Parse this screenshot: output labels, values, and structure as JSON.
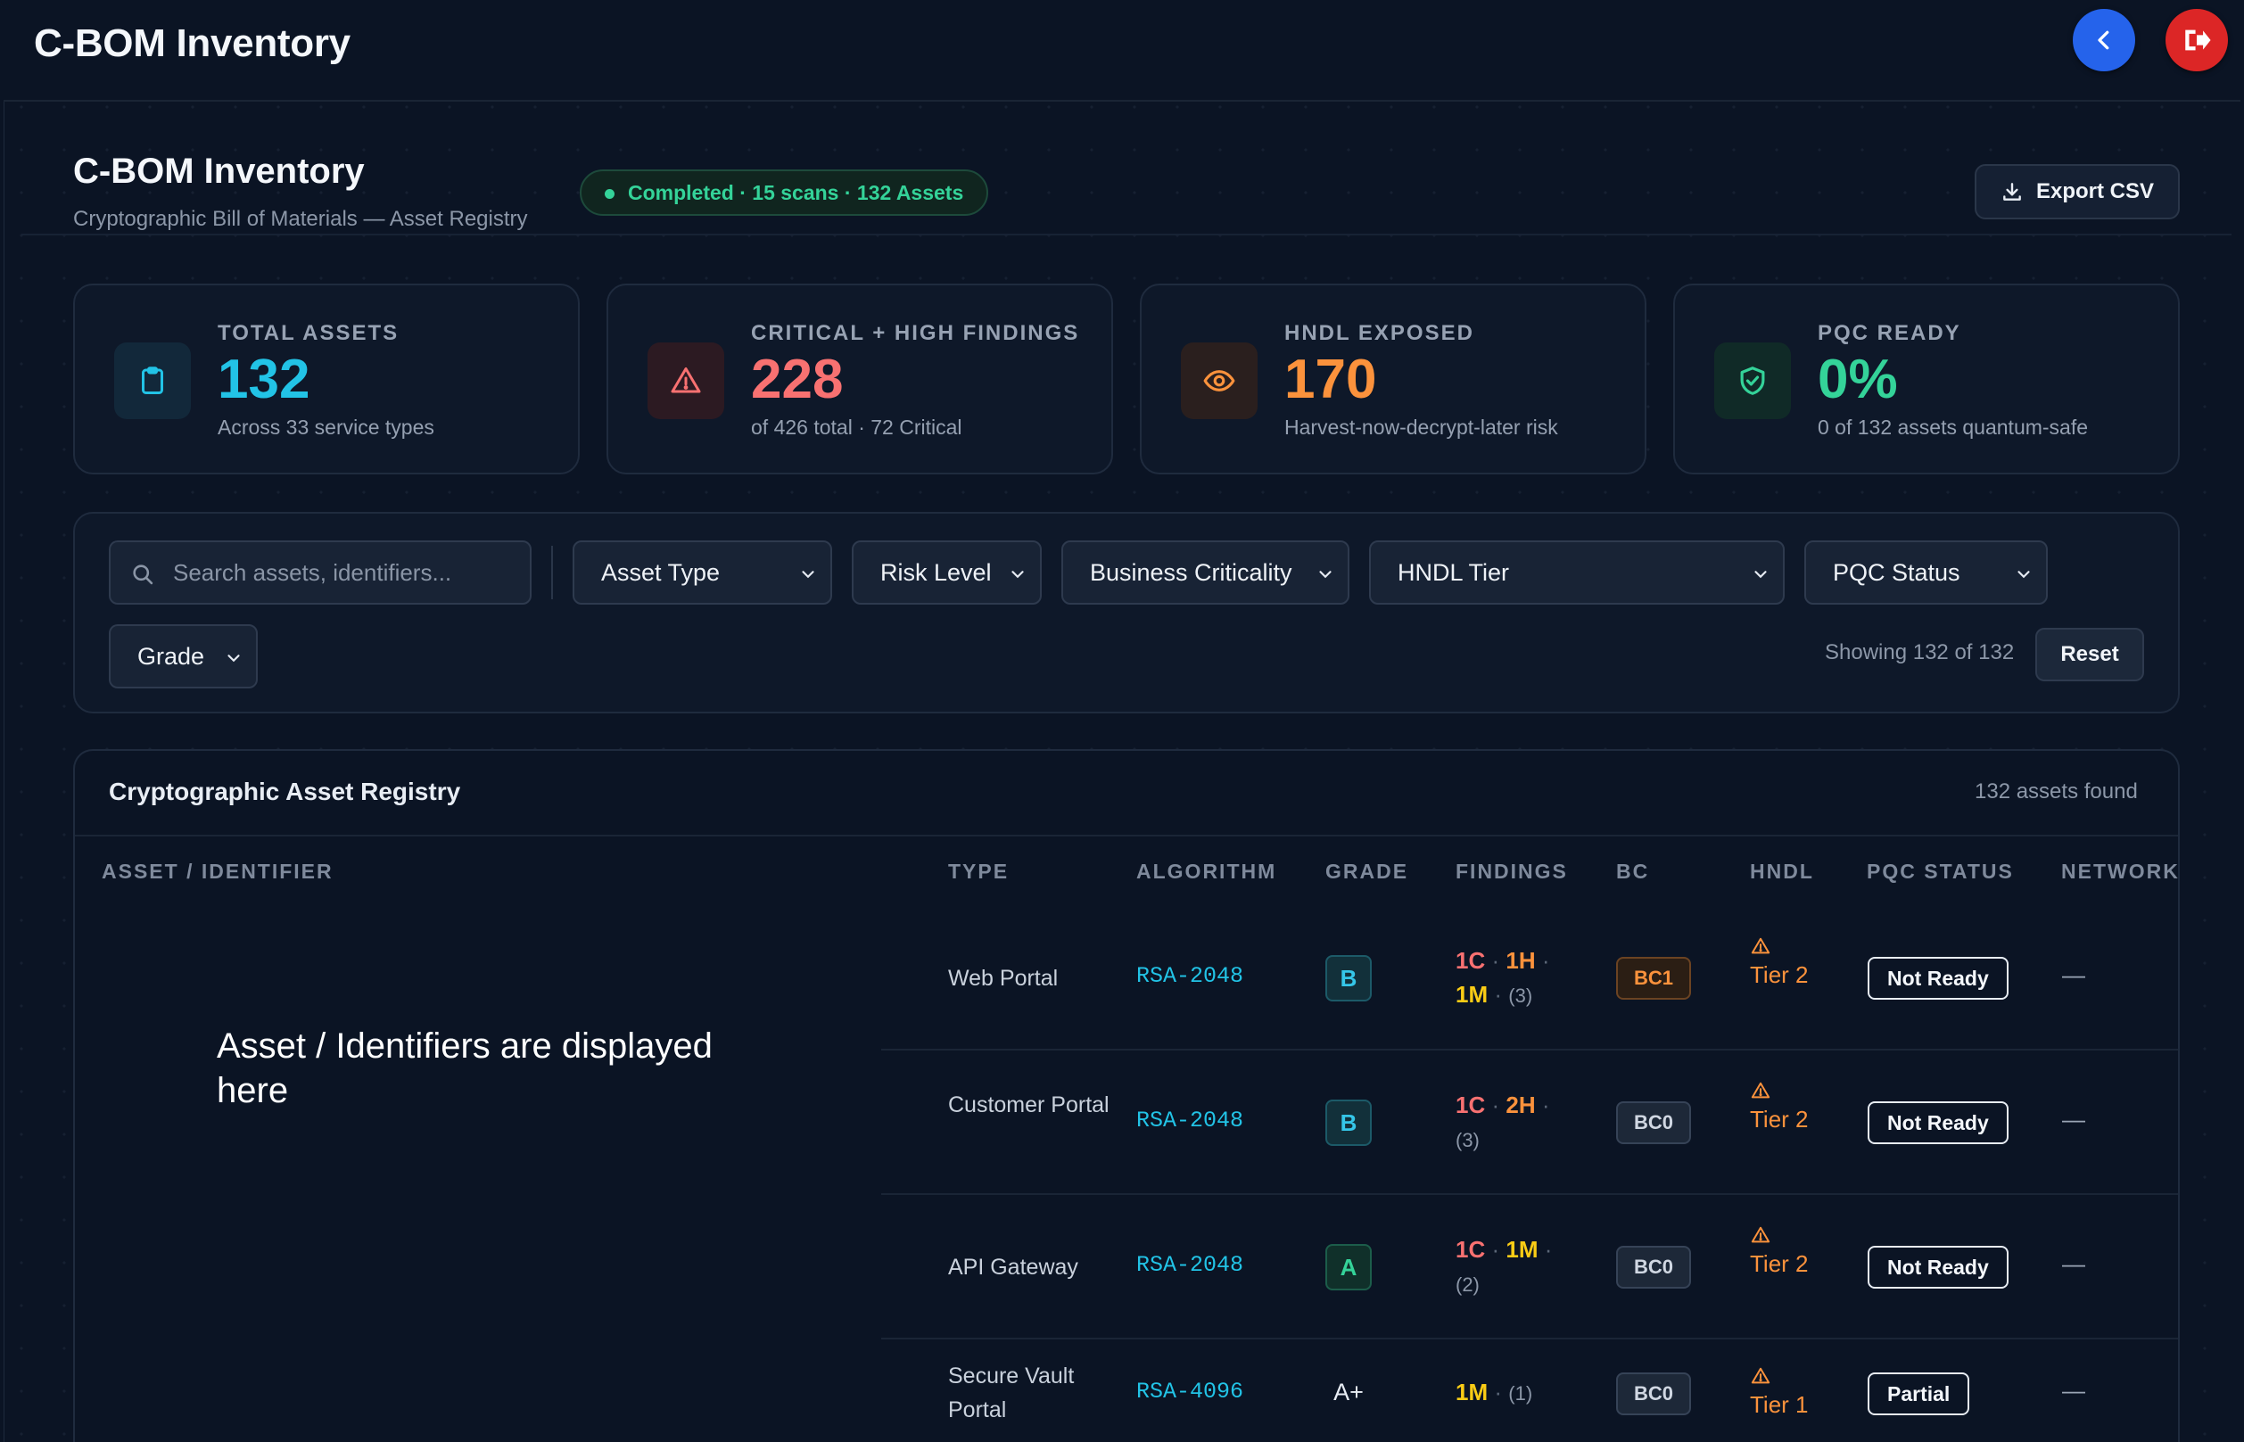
{
  "app": {
    "title": "C-BOM Inventory"
  },
  "header": {
    "title": "C-BOM Inventory",
    "subtitle": "Cryptographic Bill of Materials — Asset Registry",
    "status": "Completed · 15 scans · 132 Assets",
    "export_label": "Export CSV"
  },
  "stats": [
    {
      "label": "TOTAL ASSETS",
      "value": "132",
      "sub": "Across 33 service types",
      "icon": "clipboard-icon",
      "color": "#22c3e6"
    },
    {
      "label": "CRITICAL + HIGH FINDINGS",
      "value": "228",
      "sub": "of 426 total · 72 Critical",
      "icon": "warning-icon",
      "color": "#f87171"
    },
    {
      "label": "HNDL EXPOSED",
      "value": "170",
      "sub": "Harvest-now-decrypt-later risk",
      "icon": "eye-icon",
      "color": "#fb923c"
    },
    {
      "label": "PQC READY",
      "value": "0%",
      "sub": "0 of 132 assets quantum-safe",
      "icon": "shield-check-icon",
      "color": "#34d399"
    }
  ],
  "filters": {
    "search_placeholder": "Search assets, identifiers...",
    "asset_type": "Asset Type",
    "risk_level": "Risk Level",
    "business_criticality": "Business Criticality",
    "hndl_tier": "HNDL Tier",
    "pqc_status": "PQC Status",
    "grade": "Grade",
    "showing": "Showing 132 of 132",
    "reset_label": "Reset"
  },
  "table": {
    "title": "Cryptographic Asset Registry",
    "count": "132 assets found",
    "overlay_note": "Asset / Identifiers are displayed here",
    "columns": [
      "ASSET / IDENTIFIER",
      "TYPE",
      "ALGORITHM",
      "GRADE",
      "FINDINGS",
      "BC",
      "HNDL",
      "PQC STATUS",
      "NETWORK"
    ],
    "rows": [
      {
        "type": "Web Portal",
        "algorithm": "RSA-2048",
        "grade": "B",
        "findings": {
          "c": "1C",
          "h": "1H",
          "m": "1M",
          "total": "(3)"
        },
        "bc": "BC1",
        "hndl": "Tier 2",
        "pqc": "Not Ready",
        "network": "—"
      },
      {
        "type": "Customer Portal",
        "algorithm": "RSA-2048",
        "grade": "B",
        "findings": {
          "c": "1C",
          "h": "2H",
          "total": "(3)"
        },
        "bc": "BC0",
        "hndl": "Tier 2",
        "pqc": "Not Ready",
        "network": "—"
      },
      {
        "type": "API Gateway",
        "algorithm": "RSA-2048",
        "grade": "A",
        "findings": {
          "c": "1C",
          "m": "1M",
          "total": "(2)"
        },
        "bc": "BC0",
        "hndl": "Tier 2",
        "pqc": "Not Ready",
        "network": "—"
      },
      {
        "type": "Secure Vault Portal",
        "algorithm": "RSA-4096",
        "grade": "A+",
        "findings": {
          "m": "1M",
          "total": "(1)"
        },
        "bc": "BC0",
        "hndl": "Tier 1",
        "pqc": "Partial",
        "network": "—"
      }
    ]
  }
}
